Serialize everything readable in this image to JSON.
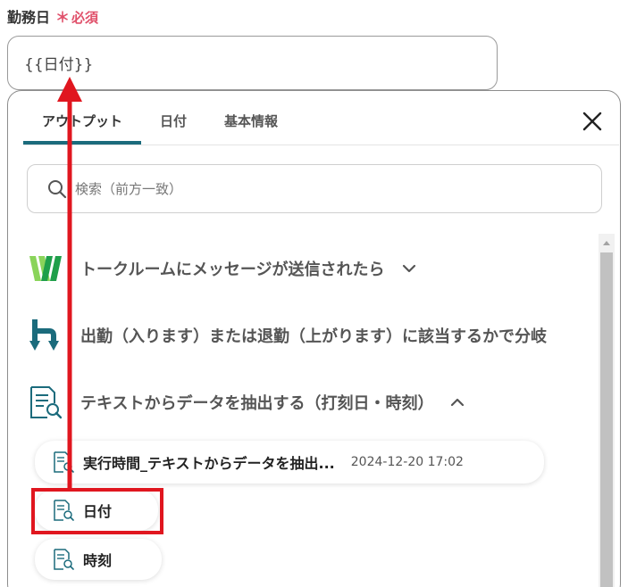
{
  "field": {
    "label": "勤務日",
    "required_mark": "＊",
    "required_text": "必須",
    "value": "{{日付}}"
  },
  "tabs": [
    {
      "label": "アウトプット",
      "active": true
    },
    {
      "label": "日付",
      "active": false
    },
    {
      "label": "基本情報",
      "active": false
    }
  ],
  "search": {
    "placeholder": "検索（前方一致）"
  },
  "sections": [
    {
      "title": "トークルームにメッセージが送信されたら",
      "icon": "w-logo-icon",
      "chevron": "down"
    },
    {
      "title": "出勤（入ります）または退勤（上がります）に該当するかで分岐",
      "icon": "branch-icon",
      "chevron": null
    },
    {
      "title": "テキストからデータを抽出する（打刻日・時刻）",
      "icon": "document-search-icon",
      "chevron": "up"
    }
  ],
  "chips": [
    {
      "label": "実行時間_テキストからデータを抽出...",
      "date": "2024-12-20 17:02"
    },
    {
      "label": "日付",
      "date": ""
    },
    {
      "label": "時刻",
      "date": ""
    }
  ],
  "colors": {
    "accent": "#1b6b7c",
    "required": "#e0506a",
    "annotation": "#e0161f",
    "w_logo_light": "#8ad45a",
    "w_logo_dark": "#1f9f4a",
    "branch": "#1b6b7c"
  }
}
